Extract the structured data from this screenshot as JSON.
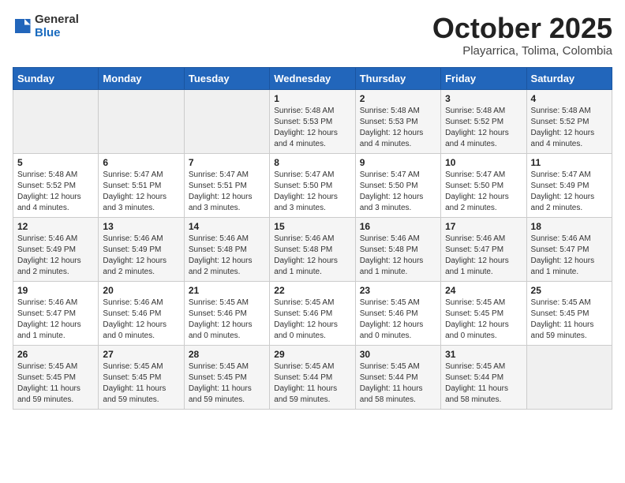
{
  "logo": {
    "general": "General",
    "blue": "Blue"
  },
  "title": "October 2025",
  "location": "Playarrica, Tolima, Colombia",
  "days_of_week": [
    "Sunday",
    "Monday",
    "Tuesday",
    "Wednesday",
    "Thursday",
    "Friday",
    "Saturday"
  ],
  "weeks": [
    [
      {
        "day": "",
        "info": ""
      },
      {
        "day": "",
        "info": ""
      },
      {
        "day": "",
        "info": ""
      },
      {
        "day": "1",
        "info": "Sunrise: 5:48 AM\nSunset: 5:53 PM\nDaylight: 12 hours\nand 4 minutes."
      },
      {
        "day": "2",
        "info": "Sunrise: 5:48 AM\nSunset: 5:53 PM\nDaylight: 12 hours\nand 4 minutes."
      },
      {
        "day": "3",
        "info": "Sunrise: 5:48 AM\nSunset: 5:52 PM\nDaylight: 12 hours\nand 4 minutes."
      },
      {
        "day": "4",
        "info": "Sunrise: 5:48 AM\nSunset: 5:52 PM\nDaylight: 12 hours\nand 4 minutes."
      }
    ],
    [
      {
        "day": "5",
        "info": "Sunrise: 5:48 AM\nSunset: 5:52 PM\nDaylight: 12 hours\nand 4 minutes."
      },
      {
        "day": "6",
        "info": "Sunrise: 5:47 AM\nSunset: 5:51 PM\nDaylight: 12 hours\nand 3 minutes."
      },
      {
        "day": "7",
        "info": "Sunrise: 5:47 AM\nSunset: 5:51 PM\nDaylight: 12 hours\nand 3 minutes."
      },
      {
        "day": "8",
        "info": "Sunrise: 5:47 AM\nSunset: 5:50 PM\nDaylight: 12 hours\nand 3 minutes."
      },
      {
        "day": "9",
        "info": "Sunrise: 5:47 AM\nSunset: 5:50 PM\nDaylight: 12 hours\nand 3 minutes."
      },
      {
        "day": "10",
        "info": "Sunrise: 5:47 AM\nSunset: 5:50 PM\nDaylight: 12 hours\nand 2 minutes."
      },
      {
        "day": "11",
        "info": "Sunrise: 5:47 AM\nSunset: 5:49 PM\nDaylight: 12 hours\nand 2 minutes."
      }
    ],
    [
      {
        "day": "12",
        "info": "Sunrise: 5:46 AM\nSunset: 5:49 PM\nDaylight: 12 hours\nand 2 minutes."
      },
      {
        "day": "13",
        "info": "Sunrise: 5:46 AM\nSunset: 5:49 PM\nDaylight: 12 hours\nand 2 minutes."
      },
      {
        "day": "14",
        "info": "Sunrise: 5:46 AM\nSunset: 5:48 PM\nDaylight: 12 hours\nand 2 minutes."
      },
      {
        "day": "15",
        "info": "Sunrise: 5:46 AM\nSunset: 5:48 PM\nDaylight: 12 hours\nand 1 minute."
      },
      {
        "day": "16",
        "info": "Sunrise: 5:46 AM\nSunset: 5:48 PM\nDaylight: 12 hours\nand 1 minute."
      },
      {
        "day": "17",
        "info": "Sunrise: 5:46 AM\nSunset: 5:47 PM\nDaylight: 12 hours\nand 1 minute."
      },
      {
        "day": "18",
        "info": "Sunrise: 5:46 AM\nSunset: 5:47 PM\nDaylight: 12 hours\nand 1 minute."
      }
    ],
    [
      {
        "day": "19",
        "info": "Sunrise: 5:46 AM\nSunset: 5:47 PM\nDaylight: 12 hours\nand 1 minute."
      },
      {
        "day": "20",
        "info": "Sunrise: 5:46 AM\nSunset: 5:46 PM\nDaylight: 12 hours\nand 0 minutes."
      },
      {
        "day": "21",
        "info": "Sunrise: 5:45 AM\nSunset: 5:46 PM\nDaylight: 12 hours\nand 0 minutes."
      },
      {
        "day": "22",
        "info": "Sunrise: 5:45 AM\nSunset: 5:46 PM\nDaylight: 12 hours\nand 0 minutes."
      },
      {
        "day": "23",
        "info": "Sunrise: 5:45 AM\nSunset: 5:46 PM\nDaylight: 12 hours\nand 0 minutes."
      },
      {
        "day": "24",
        "info": "Sunrise: 5:45 AM\nSunset: 5:45 PM\nDaylight: 12 hours\nand 0 minutes."
      },
      {
        "day": "25",
        "info": "Sunrise: 5:45 AM\nSunset: 5:45 PM\nDaylight: 11 hours\nand 59 minutes."
      }
    ],
    [
      {
        "day": "26",
        "info": "Sunrise: 5:45 AM\nSunset: 5:45 PM\nDaylight: 11 hours\nand 59 minutes."
      },
      {
        "day": "27",
        "info": "Sunrise: 5:45 AM\nSunset: 5:45 PM\nDaylight: 11 hours\nand 59 minutes."
      },
      {
        "day": "28",
        "info": "Sunrise: 5:45 AM\nSunset: 5:45 PM\nDaylight: 11 hours\nand 59 minutes."
      },
      {
        "day": "29",
        "info": "Sunrise: 5:45 AM\nSunset: 5:44 PM\nDaylight: 11 hours\nand 59 minutes."
      },
      {
        "day": "30",
        "info": "Sunrise: 5:45 AM\nSunset: 5:44 PM\nDaylight: 11 hours\nand 58 minutes."
      },
      {
        "day": "31",
        "info": "Sunrise: 5:45 AM\nSunset: 5:44 PM\nDaylight: 11 hours\nand 58 minutes."
      },
      {
        "day": "",
        "info": ""
      }
    ]
  ]
}
